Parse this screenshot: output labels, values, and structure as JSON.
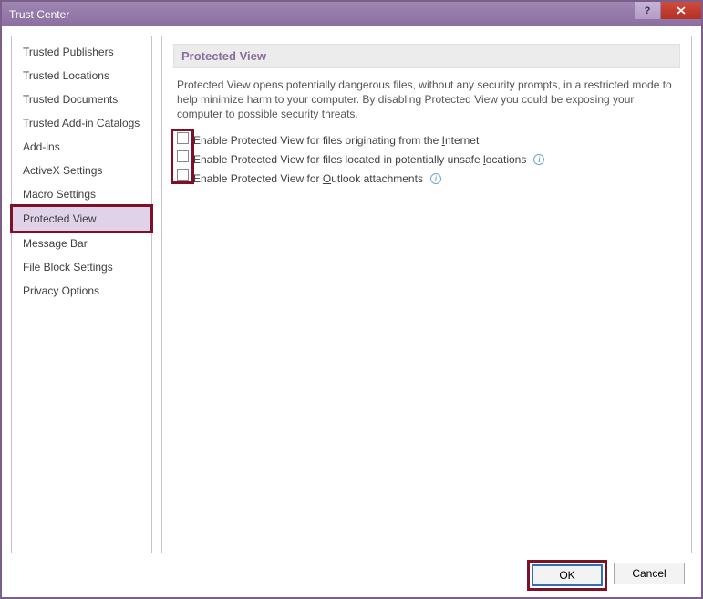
{
  "window": {
    "title": "Trust Center"
  },
  "sidebar": {
    "items": [
      {
        "label": "Trusted Publishers"
      },
      {
        "label": "Trusted Locations"
      },
      {
        "label": "Trusted Documents"
      },
      {
        "label": "Trusted Add-in Catalogs"
      },
      {
        "label": "Add-ins"
      },
      {
        "label": "ActiveX Settings"
      },
      {
        "label": "Macro Settings"
      },
      {
        "label": "Protected View"
      },
      {
        "label": "Message Bar"
      },
      {
        "label": "File Block Settings"
      },
      {
        "label": "Privacy Options"
      }
    ],
    "selected_index": 7
  },
  "main": {
    "heading": "Protected View",
    "description": "Protected View opens potentially dangerous files, without any security prompts, in a restricted mode to help minimize harm to your computer. By disabling Protected View you could be exposing your computer to possible security threats.",
    "options": [
      {
        "label": "Enable Protected View for files originating from the Internet",
        "checked": false,
        "info": false
      },
      {
        "label": "Enable Protected View for files located in potentially unsafe locations",
        "checked": false,
        "info": true
      },
      {
        "label": "Enable Protected View for Outlook attachments",
        "checked": false,
        "info": true
      }
    ]
  },
  "footer": {
    "ok": "OK",
    "cancel": "Cancel"
  }
}
